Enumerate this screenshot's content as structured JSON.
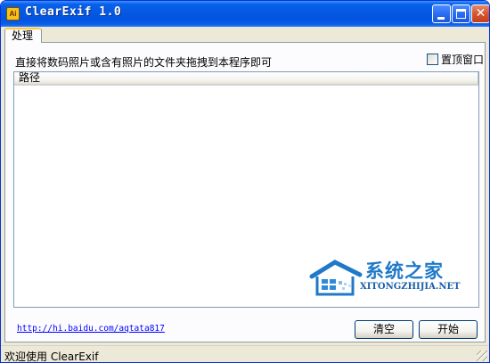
{
  "window": {
    "title": "ClearExif 1.0",
    "app_icon_text": "Ai",
    "close_glyph": "✕"
  },
  "tabs": [
    {
      "label": "处理",
      "selected": true
    }
  ],
  "main": {
    "instruction": "直接将数码照片或含有照片的文件夹拖拽到本程序即可",
    "topmost_label": "置顶窗口",
    "topmost_checked": false,
    "list": {
      "columns": [
        "路径"
      ],
      "rows": []
    },
    "link": "http://hi.baidu.com/aqtata817",
    "clear_button": "清空",
    "start_button": "开始"
  },
  "watermark": {
    "title": "系统之家",
    "url": "XITONGZHIJIA.NET"
  },
  "status": {
    "text": "欢迎使用 ClearExif"
  },
  "colors": {
    "titlebar": "#0458e2",
    "tab_accent": "#ffc83c",
    "link": "#0000ff",
    "watermark": "#1f79c8"
  }
}
